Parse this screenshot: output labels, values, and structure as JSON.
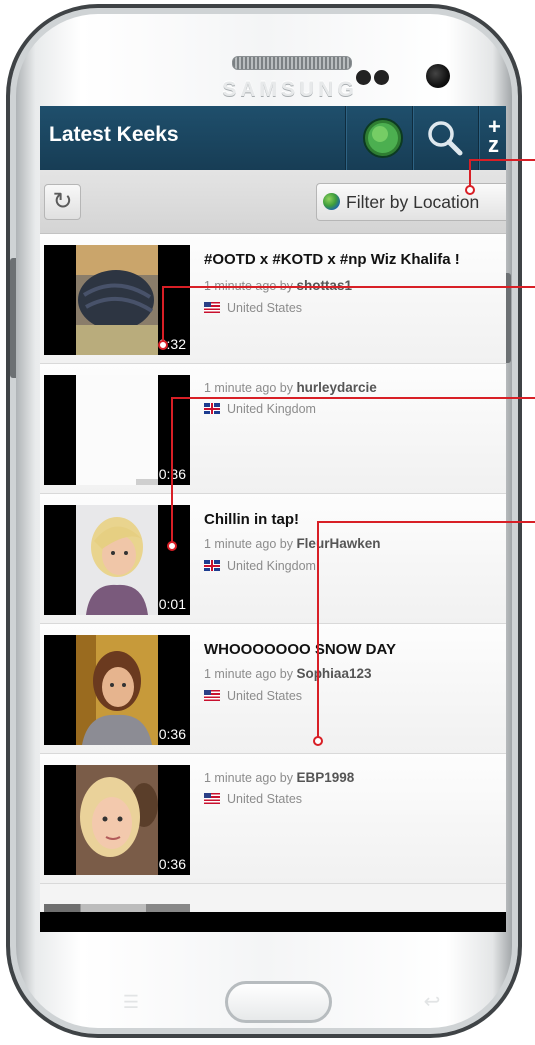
{
  "device": {
    "brand": "SAMSUNG"
  },
  "actionbar": {
    "title": "Latest Keeks",
    "icons": [
      "globe-icon",
      "search-icon",
      "more-icon"
    ]
  },
  "toolbar": {
    "refresh_icon": "refresh-icon",
    "filter_label": "Filter by Location"
  },
  "keeks": [
    {
      "title": "#OOTD x #KOTD x #np Wiz Khalifa !",
      "time": "1 minute ago by",
      "user": "shottas1",
      "country": "United States",
      "flag": "us",
      "duration": "0:32"
    },
    {
      "title": "",
      "time": "1 minute ago by",
      "user": "hurleydarcie",
      "country": "United Kingdom",
      "flag": "uk",
      "duration": "0:36"
    },
    {
      "title": "Chillin in tap!",
      "time": "1 minute ago by",
      "user": "FleurHawken",
      "country": "United Kingdom",
      "flag": "uk",
      "duration": "0:01"
    },
    {
      "title": "WHOOOOOOO SNOW DAY",
      "time": "1 minute ago by",
      "user": "Sophiaa123",
      "country": "United States",
      "flag": "us",
      "duration": "0:36"
    },
    {
      "title": "",
      "time": "1 minute ago by",
      "user": "EBP1998",
      "country": "United States",
      "flag": "us",
      "duration": "0:36"
    }
  ],
  "colors": {
    "actionbar": "#1f4f6c",
    "callout": "#d81f26"
  }
}
